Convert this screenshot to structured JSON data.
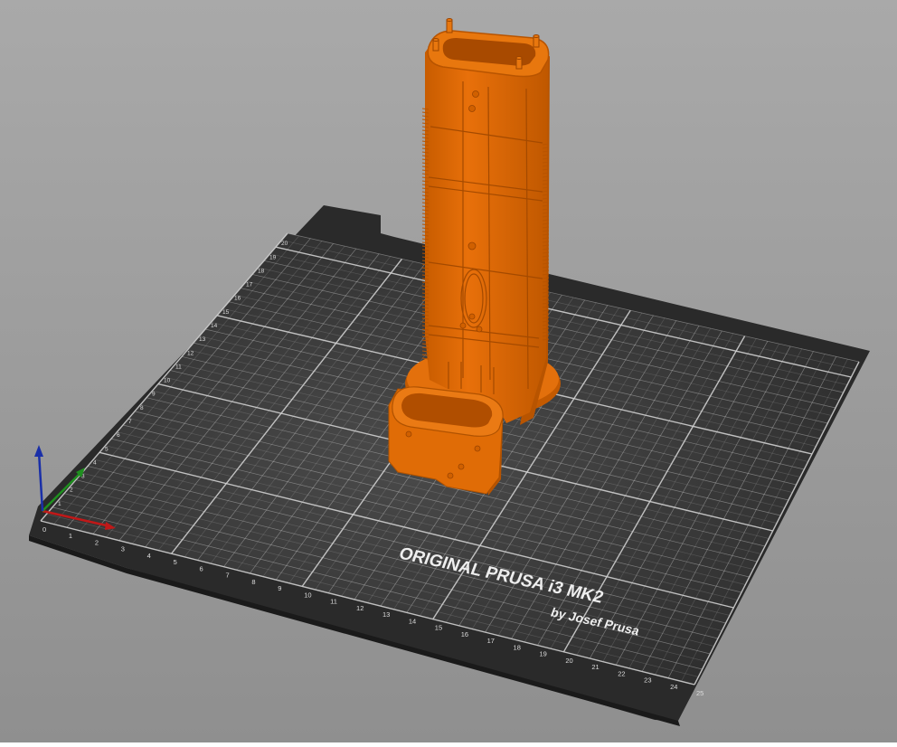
{
  "scene": {
    "background_top": "#a9a9a9",
    "background_bottom": "#8f8f8f",
    "bed_color": "#2b2b2b",
    "grid_color": "#cfcfcf",
    "model_color": "#e26a00",
    "model_shadow": "#b85400",
    "model_highlight": "#f28a2a"
  },
  "bed": {
    "brand_line1": "ORIGINAL PRUSA i3  MK2",
    "brand_line2": "by Josef Prusa",
    "x_ticks": [
      "0",
      "1",
      "2",
      "3",
      "4",
      "5",
      "6",
      "7",
      "8",
      "9",
      "10",
      "11",
      "12",
      "13",
      "14",
      "15",
      "16",
      "17",
      "18",
      "19",
      "20",
      "21",
      "22",
      "23",
      "24",
      "25"
    ],
    "y_ticks": [
      "1",
      "2",
      "3",
      "4",
      "5",
      "6",
      "7",
      "8",
      "9",
      "10",
      "11",
      "12",
      "13",
      "14",
      "15",
      "16",
      "17",
      "18",
      "19",
      "20"
    ]
  },
  "axes": {
    "x_color": "#c01818",
    "y_color": "#1f8f1f",
    "z_color": "#1a2fa8"
  }
}
